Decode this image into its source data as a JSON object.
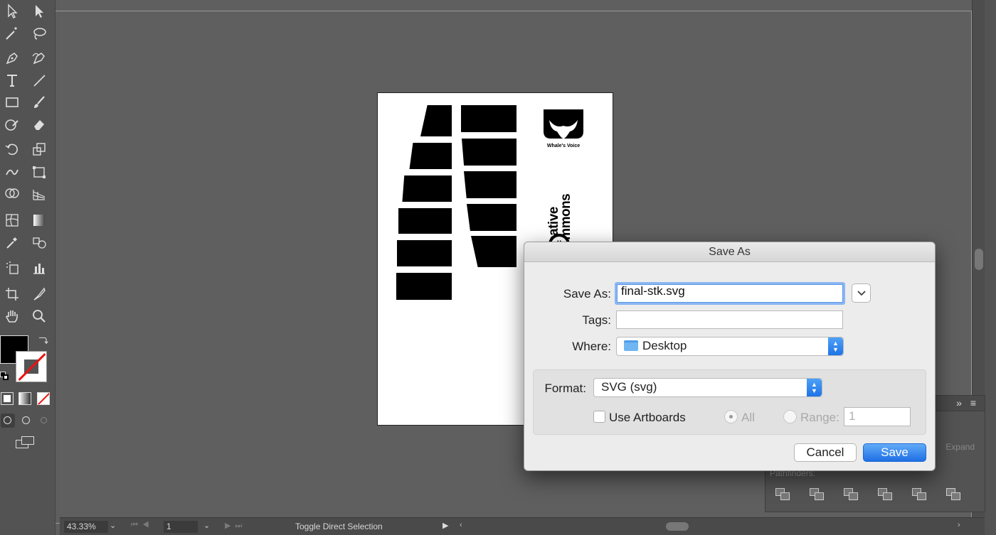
{
  "app": {
    "status_bar": {
      "zoom": "43.33%",
      "artboard_number": "1",
      "status_text": "Toggle Direct Selection"
    },
    "tools": [
      "selection-tool",
      "direct-selection-tool",
      "magic-wand-tool",
      "lasso-tool",
      "pen-tool",
      "curvature-tool",
      "type-tool",
      "line-segment-tool",
      "rectangle-tool",
      "paintbrush-tool",
      "shaper-tool",
      "eraser-tool",
      "rotate-tool",
      "scale-tool",
      "width-tool",
      "free-transform-tool",
      "shape-builder-tool",
      "perspective-grid-tool",
      "mesh-tool",
      "gradient-tool",
      "eyedropper-tool",
      "blend-tool",
      "symbol-sprayer-tool",
      "column-graph-tool",
      "artboard-tool",
      "slice-tool",
      "hand-tool",
      "zoom-tool"
    ],
    "colors": {
      "fill": "#000000",
      "stroke": "none",
      "accent": "#1e6fe4"
    }
  },
  "artboard": {
    "logo_caption": "Whale's Voice",
    "cc_text_line1": "creative",
    "cc_text_line2": "commons",
    "cc_badge": "cc"
  },
  "pathfinder": {
    "section_label": "Pathfinders:",
    "expand_label": "Expand"
  },
  "dialog": {
    "title": "Save As",
    "save_as_label": "Save As:",
    "filename_value": "final-stk.svg",
    "tags_label": "Tags:",
    "tags_value": "",
    "where_label": "Where:",
    "where_value": "Desktop",
    "format_label": "Format:",
    "format_value": "SVG (svg)",
    "use_artboards_label": "Use Artboards",
    "use_artboards_checked": false,
    "all_label": "All",
    "range_label": "Range:",
    "range_value": "1",
    "cancel_label": "Cancel",
    "save_label": "Save"
  }
}
